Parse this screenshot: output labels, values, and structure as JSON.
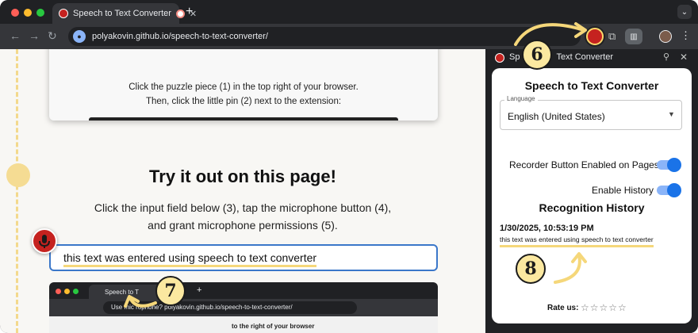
{
  "browser": {
    "tab_title": "Speech to Text Converter",
    "tab_close": "✕",
    "new_tab": "+",
    "tab_menu": "⌄",
    "address": "polyakovin.github.io/speech-to-text-converter/",
    "back": "←",
    "forward": "→",
    "reload": "↻",
    "puzzle": "⧉",
    "menu": "⋮"
  },
  "page": {
    "instruction_line1": "Click the puzzle piece (1) in the top right of your browser.",
    "instruction_line2": "Then, click the little pin (2) next to the extension:",
    "heading": "Try it out on this page!",
    "description_line1": "Click the input field below (3), tap the microphone button (4),",
    "description_line2": "and grant microphone permissions (5).",
    "input_value": "this text was entered using speech to text converter"
  },
  "mini_screenshot": {
    "tab_title": "Speech to T",
    "new_tab": "+",
    "url": "polyakovin.github.io/speech-to-text-converter/",
    "url_prefix": "Use mic",
    "url_prefix2": "rophone?",
    "partial_text": "to the right of your browser"
  },
  "side_panel": {
    "header_title": "Speech to Text Converter",
    "header_title_visible": "Sp",
    "header_title_tail": "Text Converter",
    "pin": "⚲",
    "close": "✕",
    "title": "Speech to Text Converter",
    "language_label": "Language",
    "language_value": "English (United States)",
    "caret": "▼",
    "toggle_recorder_label": "Recorder Button Enabled on Pages",
    "toggle_recorder_on": true,
    "toggle_history_label": "Enable History",
    "toggle_history_on": true,
    "history_title": "Recognition History",
    "history_entries": [
      {
        "datetime": "1/30/2025, 10:53:19 PM",
        "text": "this text was entered using speech to text converter"
      }
    ],
    "rate_label": "Rate us:",
    "rating_stars": "☆☆☆☆☆",
    "rating_value": 0
  },
  "annotations": {
    "step6": "6",
    "step7": "7",
    "step8": "8"
  },
  "colors": {
    "accent_yellow": "#f5d77a",
    "brand_red": "#c5221f",
    "toggle_blue": "#1a73e8",
    "input_border": "#3b77c9"
  }
}
